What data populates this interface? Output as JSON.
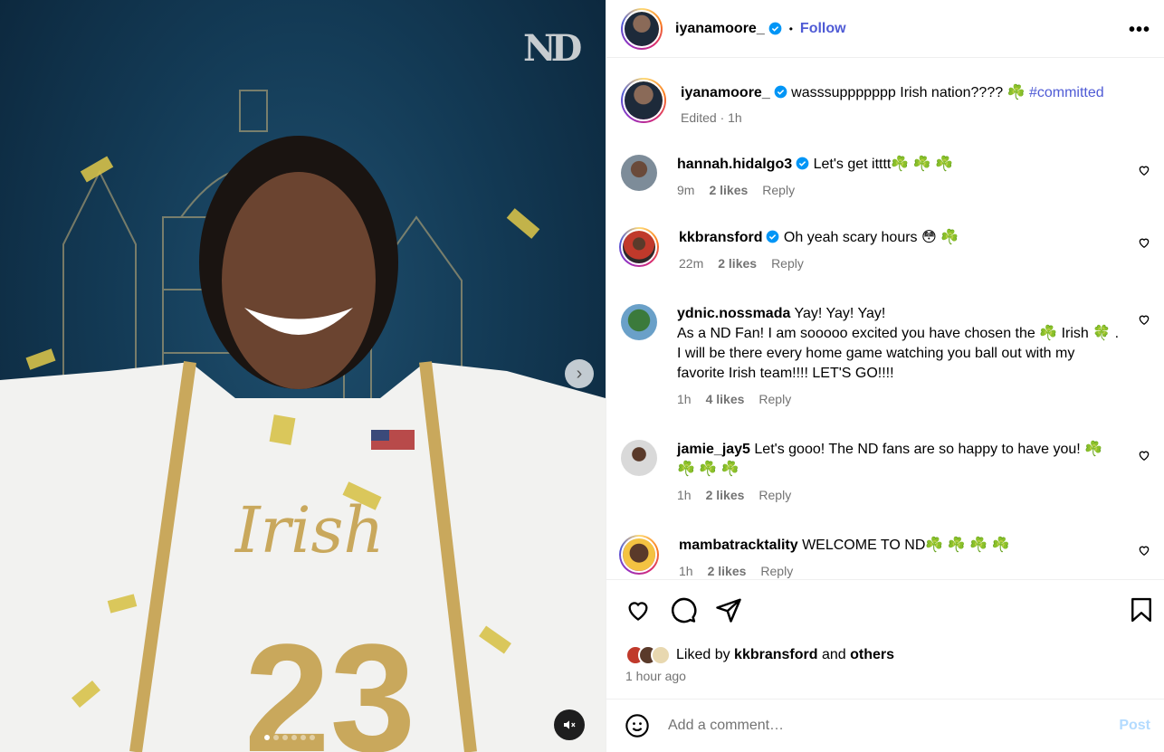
{
  "media": {
    "logo_text": "ND",
    "jersey_text": "Irish",
    "jersey_number": "23",
    "carousel": {
      "total": 6,
      "active_index": 0
    }
  },
  "header": {
    "username": "iyanamoore_",
    "separator": "•",
    "follow_label": "Follow",
    "more_label": "•••"
  },
  "caption": {
    "username": "iyanamoore_",
    "text": "wasssuppppppp Irish nation???? ☘️",
    "hashtag": "#committed",
    "edited_label": "Edited · 1h"
  },
  "comments": [
    {
      "username": "hannah.hidalgo3",
      "verified": true,
      "text": "Let's get itttt☘️ ☘️ ☘️",
      "age": "9m",
      "likes": "2 likes",
      "reply": "Reply"
    },
    {
      "username": "kkbransford",
      "verified": true,
      "text": "Oh yeah scary hours 😳 ☘️",
      "age": "22m",
      "likes": "2 likes",
      "reply": "Reply"
    },
    {
      "username": "ydnic.nossmada",
      "verified": false,
      "text": "Yay! Yay! Yay!\nAs a ND Fan! I am sooooo excited you have chosen the ☘️ Irish 🍀 . I will be there every home game watching you ball out with my favorite Irish team!!!! LET'S GO!!!!",
      "age": "1h",
      "likes": "4 likes",
      "reply": "Reply"
    },
    {
      "username": "jamie_jay5",
      "verified": false,
      "text": "Let's gooo! The ND fans are so happy to have you! ☘️ ☘️ ☘️ ☘️",
      "age": "1h",
      "likes": "2 likes",
      "reply": "Reply"
    },
    {
      "username": "mambatracktality",
      "verified": false,
      "text": "WELCOME TO ND☘️ ☘️ ☘️ ☘️",
      "age": "1h",
      "likes": "2 likes",
      "reply": "Reply"
    }
  ],
  "likes": {
    "prefix": "Liked by",
    "user": "kkbransford",
    "conj": "and",
    "others": "others"
  },
  "timestamp": "1 hour ago",
  "add_comment": {
    "placeholder": "Add a comment…",
    "post_label": "Post"
  },
  "colors": {
    "link": "#4f5bd5",
    "muted": "#737373",
    "post_disabled": "#b3dbff",
    "verified": "#0095f6"
  }
}
